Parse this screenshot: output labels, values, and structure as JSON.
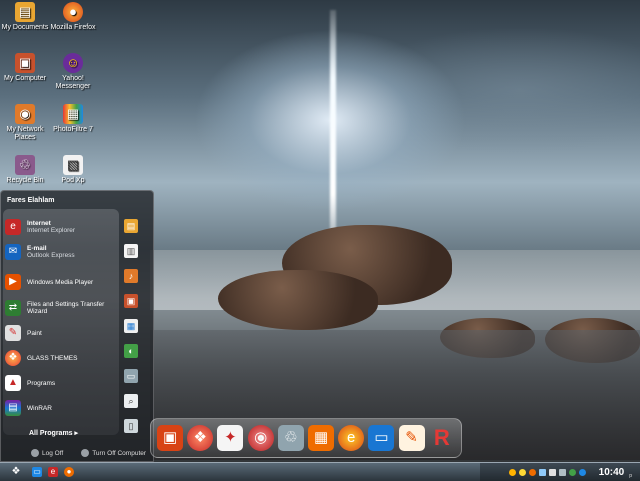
{
  "desktop": {
    "icons": [
      {
        "label": "My Documents",
        "icon": "folder-documents-icon"
      },
      {
        "label": "Mozilla Firefox",
        "icon": "firefox-icon"
      },
      {
        "label": "My Computer",
        "icon": "computer-icon"
      },
      {
        "label": "Yahoo! Messenger",
        "icon": "yahoo-messenger-icon"
      },
      {
        "label": "My Network Places",
        "icon": "network-places-icon"
      },
      {
        "label": "PhotoFiltre 7",
        "icon": "photofiltre-icon"
      },
      {
        "label": "Recycle Bin",
        "icon": "recycle-bin-icon"
      },
      {
        "label": "Pod Xp",
        "icon": "pod-xp-icon"
      }
    ]
  },
  "start_menu": {
    "user": "Fares Elahlam",
    "items": [
      {
        "title": "Internet",
        "subtitle": "Internet Explorer",
        "icon": "internet-explorer-icon"
      },
      {
        "title": "E-mail",
        "subtitle": "Outlook Express",
        "icon": "outlook-express-icon"
      },
      {
        "title": "Windows Media Player",
        "subtitle": "",
        "icon": "media-player-icon"
      },
      {
        "title": "Files and Settings Transfer Wizard",
        "subtitle": "",
        "icon": "transfer-wizard-icon"
      },
      {
        "title": "Paint",
        "subtitle": "",
        "icon": "paint-icon"
      },
      {
        "title": "GLASS THEMES",
        "subtitle": "",
        "icon": "glass-themes-icon"
      },
      {
        "title": "Programs",
        "subtitle": "",
        "icon": "programs-icon"
      },
      {
        "title": "WinRAR",
        "subtitle": "",
        "icon": "winrar-icon"
      }
    ],
    "all_programs": "All Programs",
    "log_off": "Log Off",
    "turn_off": "Turn Off Computer"
  },
  "taskbar": {
    "clock": "10:40",
    "meridiem": "p"
  },
  "colors": {
    "accent": "#2f5f8f",
    "tray": "#1b2228"
  }
}
